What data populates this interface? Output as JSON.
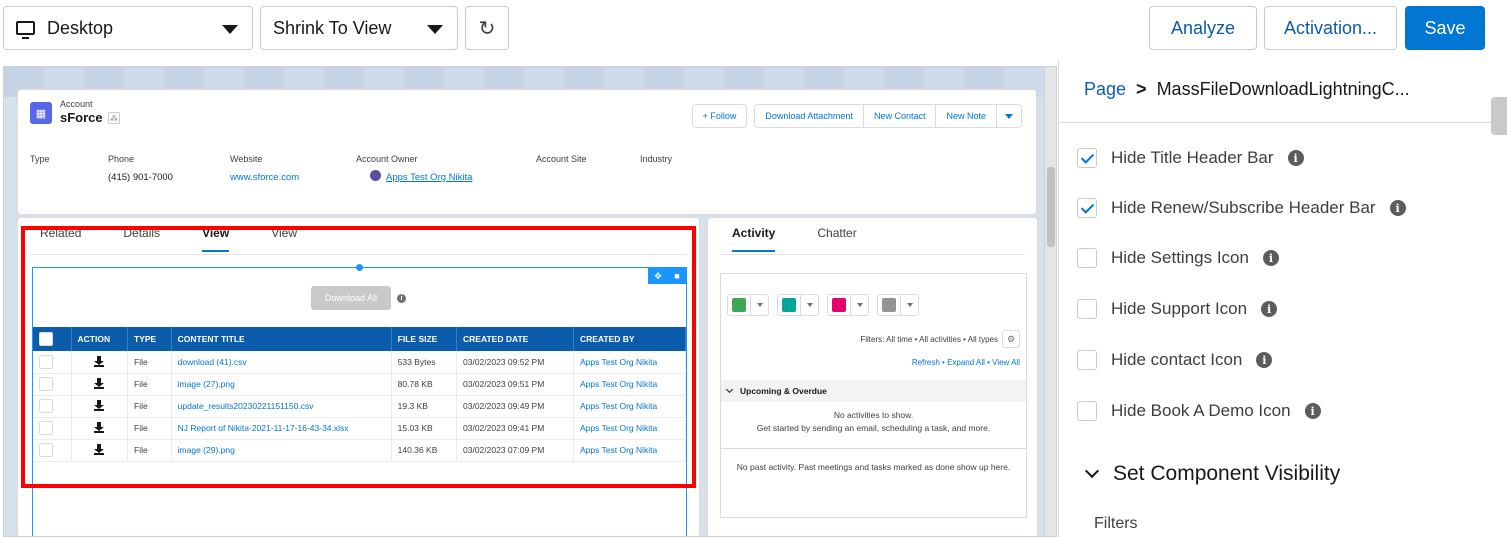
{
  "toolbar": {
    "device_value": "Desktop",
    "view_mode_value": "Shrink To View",
    "refresh_glyph": "↻",
    "analyze_label": "Analyze",
    "activation_label": "Activation...",
    "save_label": "Save"
  },
  "record": {
    "object_type": "Account",
    "name": "sForce",
    "actions": [
      "+ Follow",
      "Download Attachment",
      "New Contact",
      "New Note"
    ],
    "fields": [
      {
        "label": "Type",
        "value": ""
      },
      {
        "label": "Phone",
        "value": "(415) 901-7000"
      },
      {
        "label": "Website",
        "value": "www.sforce.com"
      },
      {
        "label": "Account Owner",
        "value": "Apps Test Org Nikita"
      },
      {
        "label": "Account Site",
        "value": ""
      },
      {
        "label": "Industry",
        "value": ""
      }
    ]
  },
  "main_tabs": [
    "Related",
    "Details",
    "View",
    "View"
  ],
  "component": {
    "download_all_label": "Download All",
    "columns": [
      "ACTION",
      "TYPE",
      "CONTENT TITLE",
      "FILE SIZE",
      "CREATED DATE",
      "CREATED BY"
    ],
    "rows": [
      {
        "type": "File",
        "title": "download (41).csv",
        "size": "533 Bytes",
        "date": "03/02/2023 09:52 PM",
        "by": "Apps Test Org Nikita"
      },
      {
        "type": "File",
        "title": "image (27).png",
        "size": "80.78 KB",
        "date": "03/02/2023 09:51 PM",
        "by": "Apps Test Org Nikita"
      },
      {
        "type": "File",
        "title": "update_results20230221151150.csv",
        "size": "19.3 KB",
        "date": "03/02/2023 09:49 PM",
        "by": "Apps Test Org Nikita"
      },
      {
        "type": "File",
        "title": "NJ Report of Nikita-2021-11-17-16-43-34.xlsx",
        "size": "15.03 KB",
        "date": "03/02/2023 09:41 PM",
        "by": "Apps Test Org Nikita"
      },
      {
        "type": "File",
        "title": "image (29).png",
        "size": "140.36 KB",
        "date": "03/02/2023 07:09 PM",
        "by": "Apps Test Org Nikita"
      }
    ]
  },
  "activity": {
    "tabs": [
      "Activity",
      "Chatter"
    ],
    "icon_colors": [
      "#3ba755",
      "#06a59a",
      "#e3066a",
      "#939393"
    ],
    "filters_text": "Filters: All time • All activities • All types",
    "links_text": "Refresh • Expand All • View All",
    "upcoming_label": "Upcoming & Overdue",
    "no_activities": "No activities to show.",
    "get_started": "Get started by sending an email, scheduling a task, and more.",
    "no_past": "No past activity. Past meetings and tasks marked as done show up here."
  },
  "panel": {
    "breadcrumb_page": "Page",
    "breadcrumb_sep": ">",
    "breadcrumb_component": "MassFileDownloadLightningC...",
    "options": [
      {
        "label": "Hide Title Header Bar",
        "checked": true
      },
      {
        "label": "Hide Renew/Subscribe Header Bar",
        "checked": true
      },
      {
        "label": "Hide Settings Icon",
        "checked": false
      },
      {
        "label": "Hide Support Icon",
        "checked": false
      },
      {
        "label": "Hide contact Icon",
        "checked": false
      },
      {
        "label": "Hide Book A Demo Icon",
        "checked": false
      }
    ],
    "section_title": "Set Component Visibility",
    "filters_label": "Filters"
  },
  "colors": {
    "brand": "#0176d3",
    "table_header": "#0b5cab",
    "highlight": "#ff0000"
  }
}
